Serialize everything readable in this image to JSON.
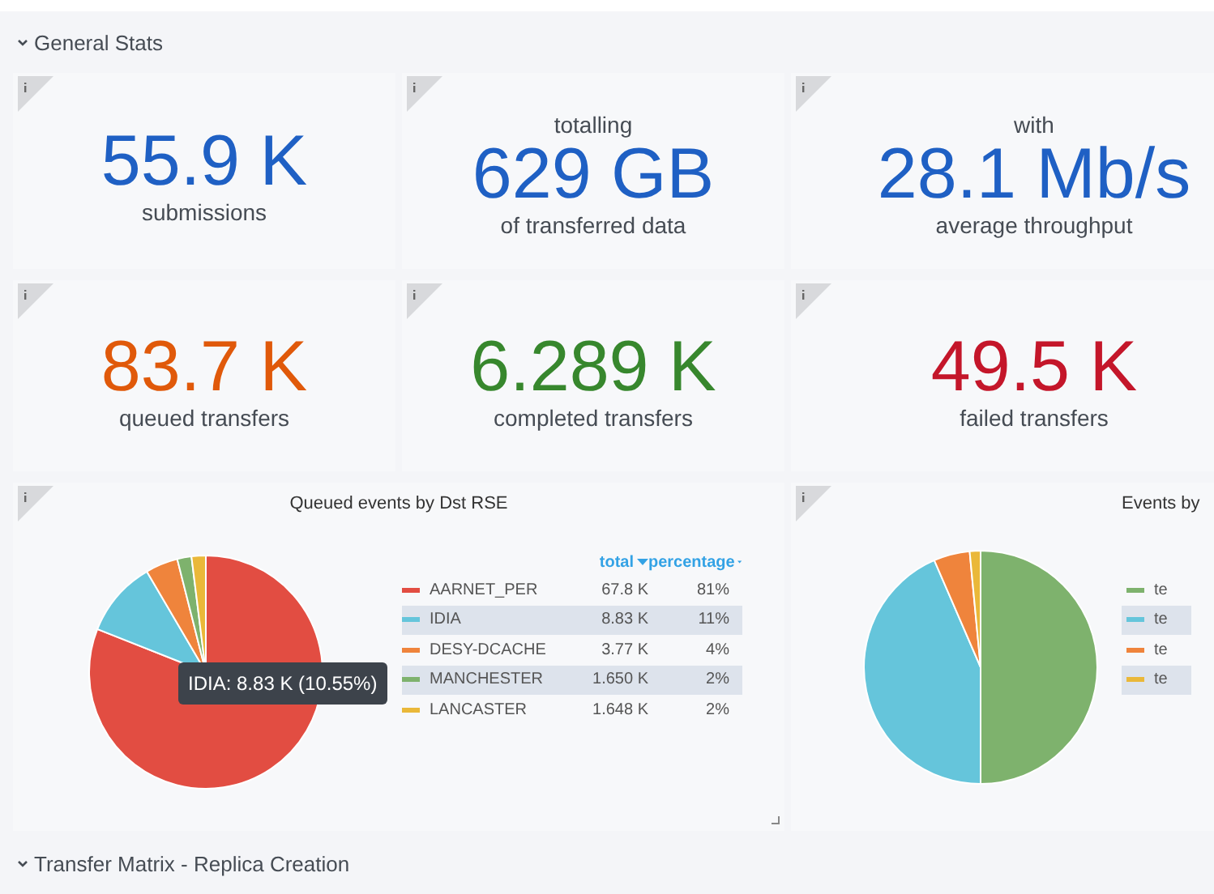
{
  "sections": [
    {
      "title": "General Stats",
      "expanded": true
    },
    {
      "title": "Transfer Matrix - Replica Creation",
      "expanded": true
    }
  ],
  "stats": [
    {
      "value": "55.9 K",
      "caption": "submissions",
      "color": "#1f60c4"
    },
    {
      "prefix": "totalling",
      "value": "629 GB",
      "caption": "of transferred data",
      "color": "#1f60c4"
    },
    {
      "prefix": "with",
      "value": "28.1 Mb/s",
      "caption": "average throughput",
      "color": "#1f60c4"
    },
    {
      "value": "83.7 K",
      "caption": "queued transfers",
      "color": "#e0590a"
    },
    {
      "value": "6.289 K",
      "caption": "completed transfers",
      "color": "#37872d"
    },
    {
      "value": "49.5 K",
      "caption": "failed transfers",
      "color": "#c4162a"
    }
  ],
  "queued_panel": {
    "title": "Queued events by Dst RSE",
    "legend_columns": [
      "percentage"
    ],
    "legend": [
      {
        "total": "67.8 K",
        "percentage": "81%",
        "color": "#e24d42"
      },
      {
        "total": "8.83 K",
        "percentage": "11%",
        "color": "#65c5db"
      },
      {
        "total": "3.77 K",
        "percentage": "4%",
        "color": "#ef843c"
      },
      {
        "total": "1.650 K",
        "percentage": "2%",
        "color": "#7eb26d"
      },
      {
        "total": "1.648 K",
        "percentage": "2%",
        "color": "#eab839"
      }
    ],
    "tooltip": "IDIA: 8.83 K (10.55%)",
    "chart_data": {
      "type": "pie",
      "categories": [
        "AARNET_PER",
        "IDIA",
        "DESY-DCACHE",
        "MANCHESTER",
        "LANCASTER"
      ],
      "series": [
        {
          "name": "total",
          "values": [
            81.01,
            10.55,
            4.5,
            1.97,
            1.97
          ]
        }
      ]
    }
  },
  "events_panel": {
    "title": "Events by",
    "legend": [
      {
        "name": "te",
        "color": "#7eb26d"
      },
      {
        "name": "te",
        "color": "#65c5db"
      },
      {
        "name": "te",
        "color": "#ef843c"
      },
      {
        "name": "te",
        "color": "#eab839"
      }
    ]
  }
}
